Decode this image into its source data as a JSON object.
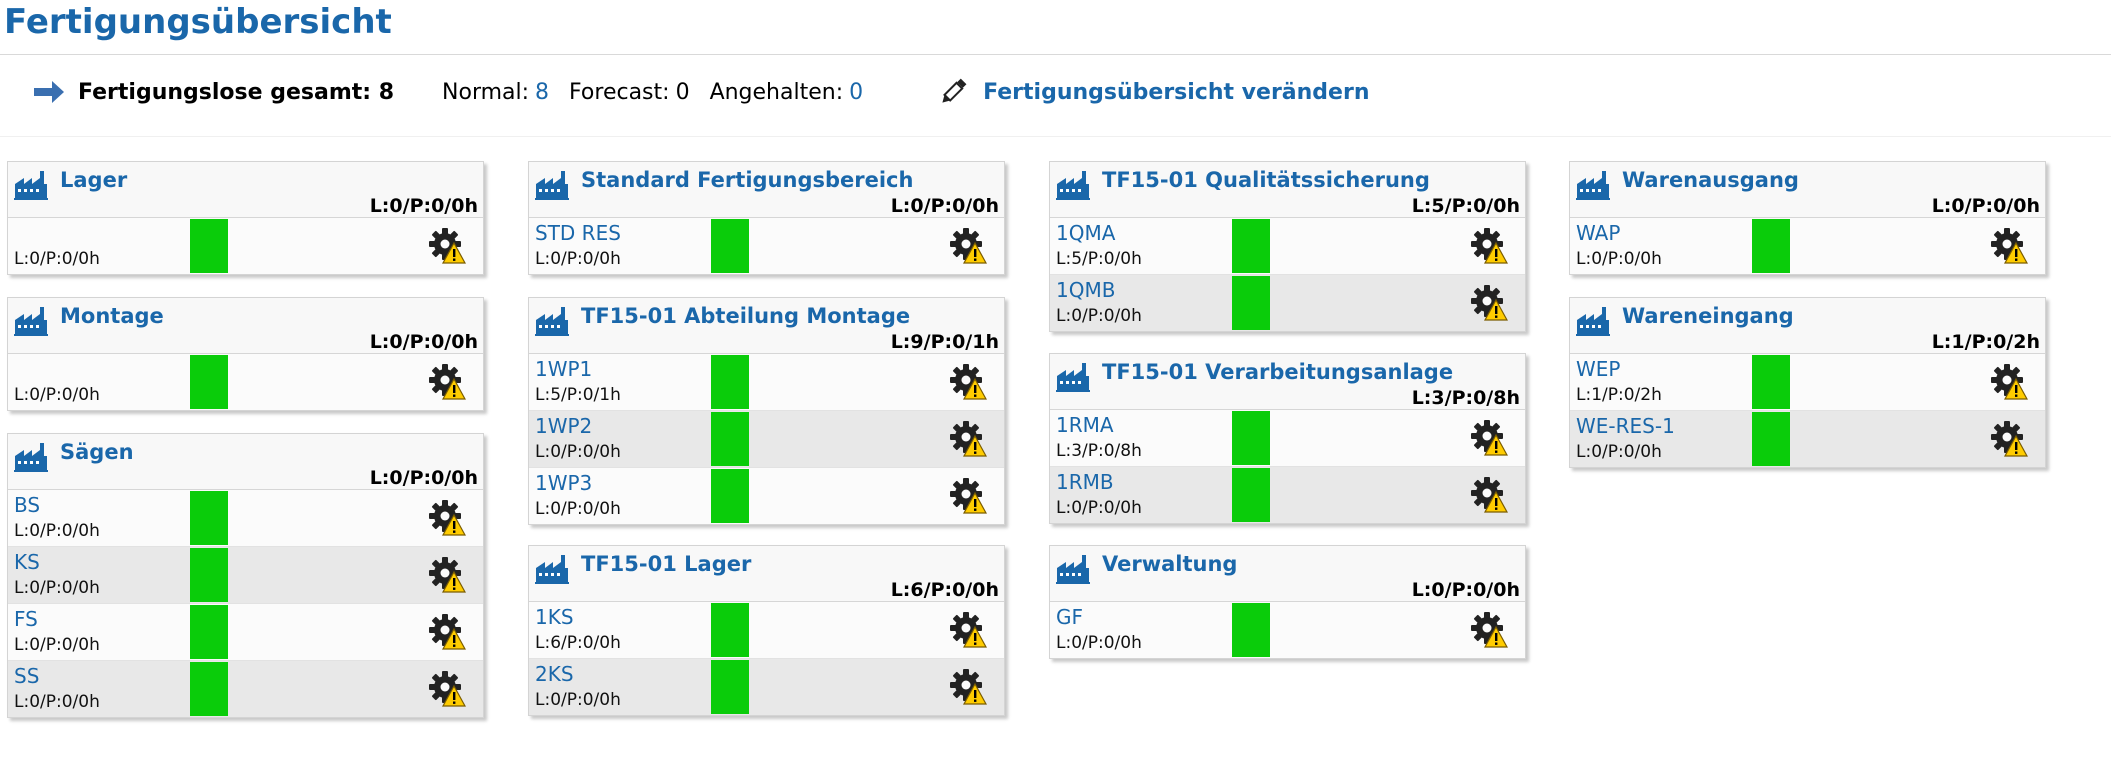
{
  "page": {
    "title": "Fertigungsübersicht"
  },
  "summary": {
    "total_label": "Fertigungslose gesamt: 8",
    "normal_label": "Normal:",
    "normal_value": "8",
    "forecast_label": "Forecast:",
    "forecast_value": "0",
    "halted_label": "Angehalten:",
    "halted_value": "0",
    "edit_link": "Fertigungsübersicht  verändern",
    "arrow_icon": "arrow-right-icon",
    "edit_icon": "pencil-icon"
  },
  "colors": {
    "accent": "#1a67aa",
    "status_bar": "#0acc0a",
    "warning": "#ffcc00",
    "gear": "#222222"
  },
  "icons": {
    "area": "factory-icon",
    "row_action": "gear-warning-icon"
  },
  "columns": [
    {
      "panels": [
        {
          "name": "Lager",
          "stats": "L:0/P:0/0h",
          "rows": [
            {
              "name": "",
              "stats": "L:0/P:0/0h"
            }
          ]
        },
        {
          "name": "Montage",
          "stats": "L:0/P:0/0h",
          "rows": [
            {
              "name": "",
              "stats": "L:0/P:0/0h"
            }
          ]
        },
        {
          "name": "Sägen",
          "stats": "L:0/P:0/0h",
          "rows": [
            {
              "name": "BS",
              "stats": "L:0/P:0/0h"
            },
            {
              "name": "KS",
              "stats": "L:0/P:0/0h"
            },
            {
              "name": "FS",
              "stats": "L:0/P:0/0h"
            },
            {
              "name": "SS",
              "stats": "L:0/P:0/0h"
            }
          ]
        }
      ]
    },
    {
      "panels": [
        {
          "name": "Standard Fertigungsbereich",
          "stats": "L:0/P:0/0h",
          "rows": [
            {
              "name": "STD RES",
              "stats": "L:0/P:0/0h"
            }
          ]
        },
        {
          "name": "TF15-01 Abteilung Montage",
          "stats": "L:9/P:0/1h",
          "rows": [
            {
              "name": "1WP1",
              "stats": "L:5/P:0/1h"
            },
            {
              "name": "1WP2",
              "stats": "L:0/P:0/0h"
            },
            {
              "name": "1WP3",
              "stats": "L:0/P:0/0h"
            }
          ]
        },
        {
          "name": "TF15-01 Lager",
          "stats": "L:6/P:0/0h",
          "rows": [
            {
              "name": "1KS",
              "stats": "L:6/P:0/0h"
            },
            {
              "name": "2KS",
              "stats": "L:0/P:0/0h"
            }
          ]
        }
      ]
    },
    {
      "panels": [
        {
          "name": "TF15-01 Qualitätssicherung",
          "stats": "L:5/P:0/0h",
          "rows": [
            {
              "name": "1QMA",
              "stats": "L:5/P:0/0h"
            },
            {
              "name": "1QMB",
              "stats": "L:0/P:0/0h"
            }
          ]
        },
        {
          "name": "TF15-01 Verarbeitungsanlage",
          "stats": "L:3/P:0/8h",
          "rows": [
            {
              "name": "1RMA",
              "stats": "L:3/P:0/8h"
            },
            {
              "name": "1RMB",
              "stats": "L:0/P:0/0h"
            }
          ]
        },
        {
          "name": "Verwaltung",
          "stats": "L:0/P:0/0h",
          "rows": [
            {
              "name": "GF",
              "stats": "L:0/P:0/0h"
            }
          ]
        }
      ]
    },
    {
      "panels": [
        {
          "name": "Warenausgang",
          "stats": "L:0/P:0/0h",
          "rows": [
            {
              "name": "WAP",
              "stats": "L:0/P:0/0h"
            }
          ]
        },
        {
          "name": "Wareneingang",
          "stats": "L:1/P:0/2h",
          "rows": [
            {
              "name": "WEP",
              "stats": "L:1/P:0/2h"
            },
            {
              "name": "WE-RES-1",
              "stats": "L:0/P:0/0h"
            }
          ]
        }
      ]
    }
  ]
}
